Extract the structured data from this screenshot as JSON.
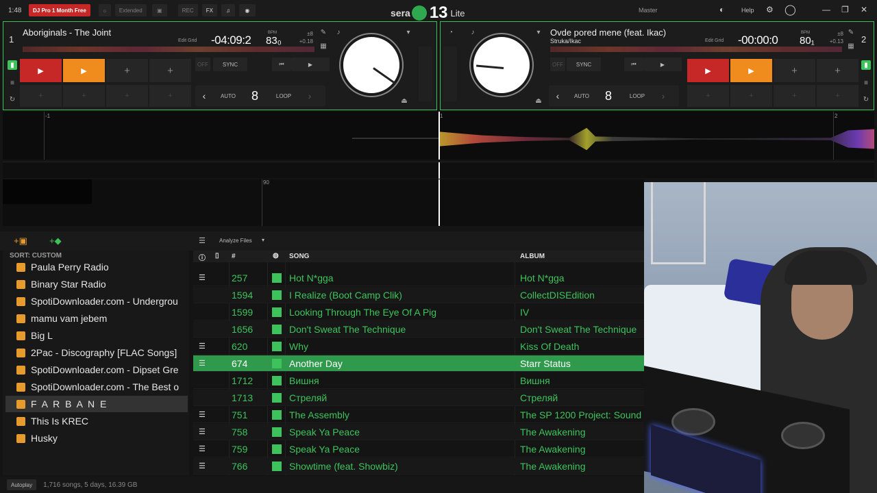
{
  "topbar": {
    "clock": "1:48",
    "promo": "DJ Pro 1 Month Free",
    "extended": "Extended",
    "rec": "REC",
    "fx": "FX",
    "brand_left": "sera",
    "brand_num": "13",
    "brand_lite": "Lite",
    "master": "Master",
    "help": "Help"
  },
  "deck1": {
    "num": "1",
    "title": "Aboriginals - The Joint",
    "edit_grid": "Edit Grid",
    "time": "-04:09:2",
    "bpm_label": "BPM",
    "bpm": "83₀",
    "pitch_top": "±8",
    "pitch_val": "+0.18",
    "off": "OFF",
    "sync": "SYNC",
    "auto": "AUTO",
    "loop_len": "8",
    "loop": "LOOP"
  },
  "deck2": {
    "num": "2",
    "title": "Ovde pored mene (feat. Ikac)",
    "artist": "Struka/Ikac",
    "edit_grid": "Edit Grid",
    "time": "-00:00:0",
    "bpm_label": "BPM",
    "bpm": "80₁",
    "pitch_top": "±8",
    "pitch_val": "+0.13",
    "off": "OFF",
    "sync": "SYNC",
    "auto": "AUTO",
    "loop_len": "8",
    "loop": "LOOP"
  },
  "waveform": {
    "mark_left": "-1",
    "mark_center": "1",
    "mark_right": "2",
    "mark_lower": "90"
  },
  "library": {
    "analyze": "Analyze Files",
    "sort_label": "SORT: CUSTOM",
    "crates": [
      "Paula Perry Radio",
      "Binary Star Radio",
      "SpotiDownloader.com - Undergrou",
      "mamu vam jebem",
      "Big L",
      "2Pac - Discography [FLAC Songs]",
      "SpotiDownloader.com - Dipset Gre",
      "SpotiDownloader.com - The Best o",
      "F A R B A N E",
      "This Is KREC",
      "Husky"
    ],
    "columns": {
      "num": "#",
      "song": "SONG",
      "album": "ALBUM"
    },
    "rows": [
      {
        "num": "257",
        "song": "Hot N*gga",
        "album": "Hot N*gga"
      },
      {
        "num": "1594",
        "song": "I Realize (Boot Camp Clik)",
        "album": "CollectDISEdition"
      },
      {
        "num": "1599",
        "song": "Looking Through The Eye Of A Pig",
        "album": "IV"
      },
      {
        "num": "1656",
        "song": "Don't Sweat The Technique",
        "album": "Don't Sweat The Technique"
      },
      {
        "num": "620",
        "song": "Why",
        "album": "Kiss Of Death"
      },
      {
        "num": "674",
        "song": "Another Day",
        "album": "Starr Status"
      },
      {
        "num": "1712",
        "song": "Вишня",
        "album": "Вишня"
      },
      {
        "num": "1713",
        "song": "Стреляй",
        "album": "Стреляй"
      },
      {
        "num": "751",
        "song": "The Assembly",
        "album": "The SP 1200 Project: Sound"
      },
      {
        "num": "758",
        "song": "Speak Ya Peace",
        "album": "The Awakening"
      },
      {
        "num": "759",
        "song": "Speak Ya Peace",
        "album": "The Awakening"
      },
      {
        "num": "766",
        "song": "Showtime (feat. Showbiz)",
        "album": "The Awakening"
      }
    ],
    "autoplay": "Autoplay",
    "stats": "1,716 songs, 5 days, 16.39 GB"
  }
}
